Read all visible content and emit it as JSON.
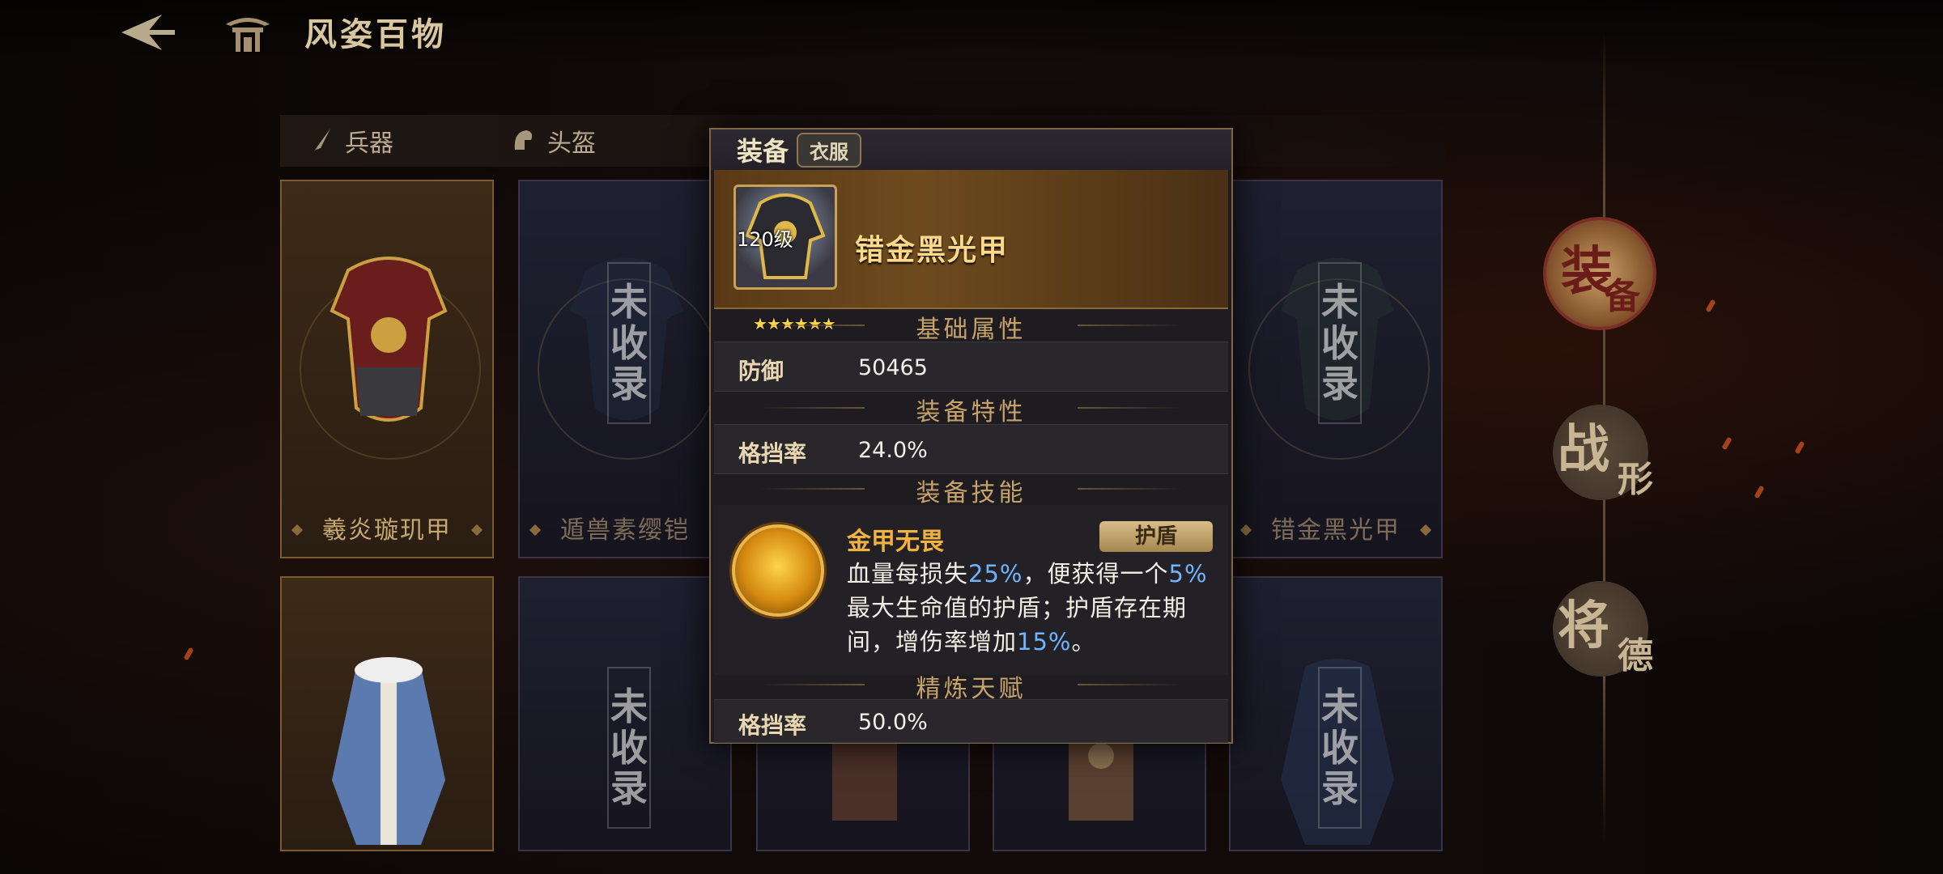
{
  "header": {
    "title": "风姿百物",
    "back_icon": "back-arrow-icon",
    "home_icon": "pavilion-icon"
  },
  "categories": [
    {
      "label": "兵器",
      "icon": "sword-icon"
    },
    {
      "label": "头盔",
      "icon": "helmet-icon"
    }
  ],
  "cards": [
    {
      "name": "羲炎璇玑甲",
      "collected": true
    },
    {
      "name": "遁兽素缨铠",
      "collected": false,
      "stamp": [
        "未",
        "收",
        "录"
      ]
    },
    {
      "name": "错金黑光甲",
      "collected": false,
      "stamp": [
        "未",
        "收",
        "录"
      ]
    },
    {
      "name": "",
      "collected": true
    },
    {
      "name": "",
      "collected": false,
      "stamp": [
        "未",
        "收",
        "录"
      ]
    },
    {
      "name": "",
      "collected": false,
      "stamp": [
        "未",
        "收",
        "录"
      ]
    }
  ],
  "right_nav": [
    {
      "big": "装",
      "small": "备",
      "active": true
    },
    {
      "big": "战",
      "small": "形",
      "active": false
    },
    {
      "big": "将",
      "small": "德",
      "active": false
    }
  ],
  "popup": {
    "title": "装备",
    "type": "衣服",
    "level": "120级",
    "stars": "★★★★★★",
    "item_name": "错金黑光甲",
    "section_base": "基础属性",
    "base_attr": {
      "key": "防御",
      "value": "50465"
    },
    "section_feature": "装备特性",
    "feature_attr": {
      "key": "格挡率",
      "value": "24.0%"
    },
    "section_skill": "装备技能",
    "skill": {
      "name": "金甲无畏",
      "tag": "护盾",
      "desc_1": "血量每损失",
      "v1": "25%",
      "desc_2": "，便获得一个",
      "v2": "5%",
      "desc_3": "最大生命值的护盾；护盾存在期间，增伤率增加",
      "v3": "15%",
      "desc_4": "。"
    },
    "section_refine": "精炼天赋",
    "refine_attr": {
      "key": "格挡率",
      "value": "50.0%"
    }
  },
  "colors": {
    "accent_gold": "#fcd98a",
    "highlight_blue": "#6fb4ff",
    "border": "#7d6640"
  }
}
